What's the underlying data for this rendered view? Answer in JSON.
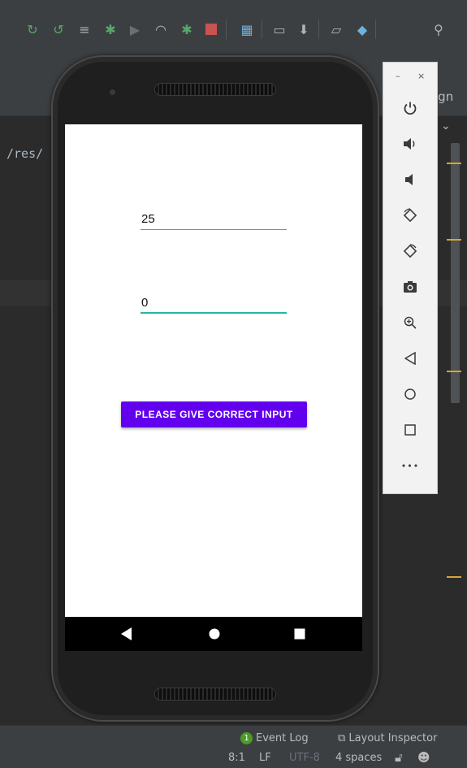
{
  "ide": {
    "path_fragment": "/res/",
    "design_fragment": "ign",
    "colors": {
      "accent": "#6200ee",
      "focus": "#26b5a7",
      "gutter_mark": "#d6a534"
    },
    "toolbar_icons": [
      "apply-changes-icon",
      "apply-code-changes-icon",
      "logcat-icon",
      "debug-icon",
      "attach-debugger-icon",
      "profile-icon",
      "debug-tests-icon",
      "stop-icon",
      "project-structure-icon",
      "avd-manager-icon",
      "sdk-manager-icon",
      "device-file-icon",
      "sync-icon",
      "search-icon"
    ],
    "status": {
      "event_log_count": "1",
      "event_log": "Event Log",
      "layout_inspector": "Layout Inspector",
      "position": "8:1",
      "line_ending": "LF",
      "encoding": "UTF-8",
      "indent": "4 spaces"
    }
  },
  "app": {
    "field1_value": "25",
    "field2_value": "0",
    "button_label": "PLEASE GIVE CORRECT INPUT"
  },
  "emulator": {
    "minimize": "–",
    "close": "×",
    "controls": [
      "power-icon",
      "volume-up-icon",
      "volume-down-icon",
      "rotate-left-icon",
      "rotate-right-icon",
      "screenshot-icon",
      "zoom-icon",
      "back-icon",
      "home-icon",
      "overview-icon",
      "more-icon"
    ],
    "more_label": "•••"
  }
}
